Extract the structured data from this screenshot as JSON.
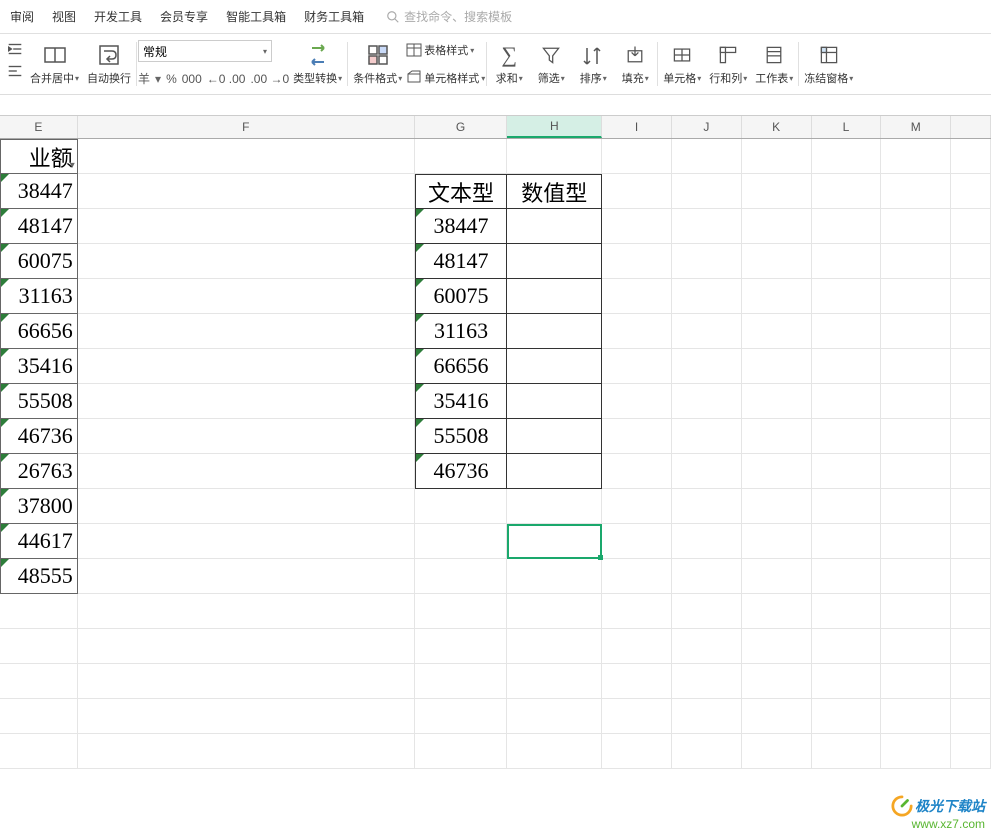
{
  "tabs": [
    "审阅",
    "视图",
    "开发工具",
    "会员专享",
    "智能工具箱",
    "财务工具箱"
  ],
  "search_placeholder": "查找命令、搜索模板",
  "ribbon": {
    "merge": "合并居中",
    "wrap": "自动换行",
    "num_format": "常规",
    "type_convert": "类型转换",
    "cond_format": "条件格式",
    "table_style": "表格样式",
    "cell_style": "单元格样式",
    "sum": "求和",
    "filter": "筛选",
    "sort": "排序",
    "fill": "填充",
    "cells": "单元格",
    "rowcol": "行和列",
    "sheet": "工作表",
    "freeze": "冻结窗格",
    "currency": "羊",
    "percent": "%",
    "comma": "000",
    "dec_inc": "←0 .00",
    "dec_dec": ".00 →0"
  },
  "columns": [
    "E",
    "F",
    "G",
    "H",
    "I",
    "J",
    "K",
    "L",
    "M",
    ""
  ],
  "e_header": "业额",
  "e_values": [
    "38447",
    "48147",
    "60075",
    "31163",
    "66656",
    "35416",
    "55508",
    "46736",
    "26763",
    "37800",
    "44617",
    "48555"
  ],
  "g_header": "文本型",
  "h_header": "数值型",
  "g_values": [
    "38447",
    "48147",
    "60075",
    "31163",
    "66656",
    "35416",
    "55508",
    "46736"
  ],
  "selected_col": "H",
  "watermark": {
    "line1": "极光下载站",
    "line2": "www.xz7.com"
  }
}
